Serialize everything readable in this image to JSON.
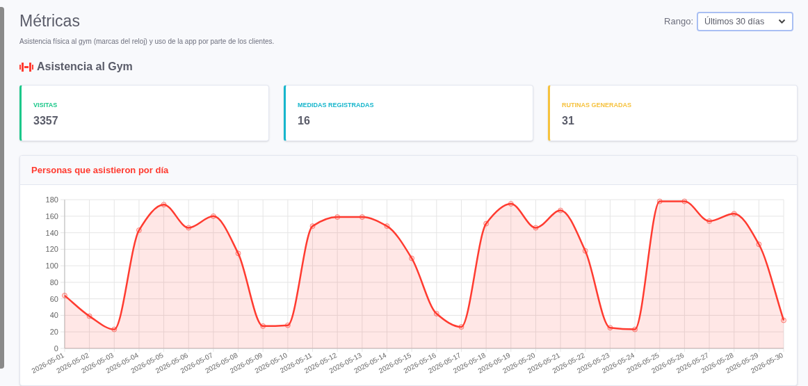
{
  "page": {
    "title": "Métricas",
    "subtitle": "Asistencia física al gym (marcas del reloj) y uso de la app por parte de los clientes."
  },
  "range": {
    "label": "Rango:",
    "value": "Últimos 30 días"
  },
  "section": {
    "title": "Asistencia al Gym"
  },
  "stats": [
    {
      "label": "VISITAS",
      "value": "3357",
      "color": "#1cc88a"
    },
    {
      "label": "MEDIDAS REGISTRADAS",
      "value": "16",
      "color": "#17b6cc"
    },
    {
      "label": "RUTINAS GENERADAS",
      "value": "31",
      "color": "#f6c23e"
    }
  ],
  "chart_card": {
    "title": "Personas que asistieron por día",
    "chart_data": {
      "type": "area",
      "grid": true,
      "ylim": [
        0,
        180
      ],
      "yticks": [
        0,
        20,
        40,
        60,
        80,
        100,
        120,
        140,
        160,
        180
      ],
      "categories": [
        "2026-05-01",
        "2026-05-02",
        "2026-05-03",
        "2026-05-04",
        "2026-05-05",
        "2026-05-06",
        "2026-05-07",
        "2026-05-08",
        "2026-05-09",
        "2026-05-10",
        "2026-05-11",
        "2026-05-12",
        "2026-05-13",
        "2026-05-14",
        "2026-05-15",
        "2026-05-16",
        "2026-05-17",
        "2026-05-18",
        "2026-05-19",
        "2026-05-20",
        "2026-05-21",
        "2026-05-22",
        "2026-05-23",
        "2026-05-24",
        "2026-05-25",
        "2026-05-26",
        "2026-05-27",
        "2026-05-28",
        "2026-05-29",
        "2026-05-30"
      ],
      "series": [
        {
          "color": "#ff3b30",
          "values": [
            64,
            39,
            23,
            143,
            174,
            146,
            160,
            115,
            27,
            28,
            148,
            159,
            159,
            148,
            109,
            42,
            26,
            151,
            175,
            146,
            167,
            118,
            25,
            23,
            178,
            178,
            154,
            163,
            126,
            34
          ]
        }
      ]
    }
  }
}
